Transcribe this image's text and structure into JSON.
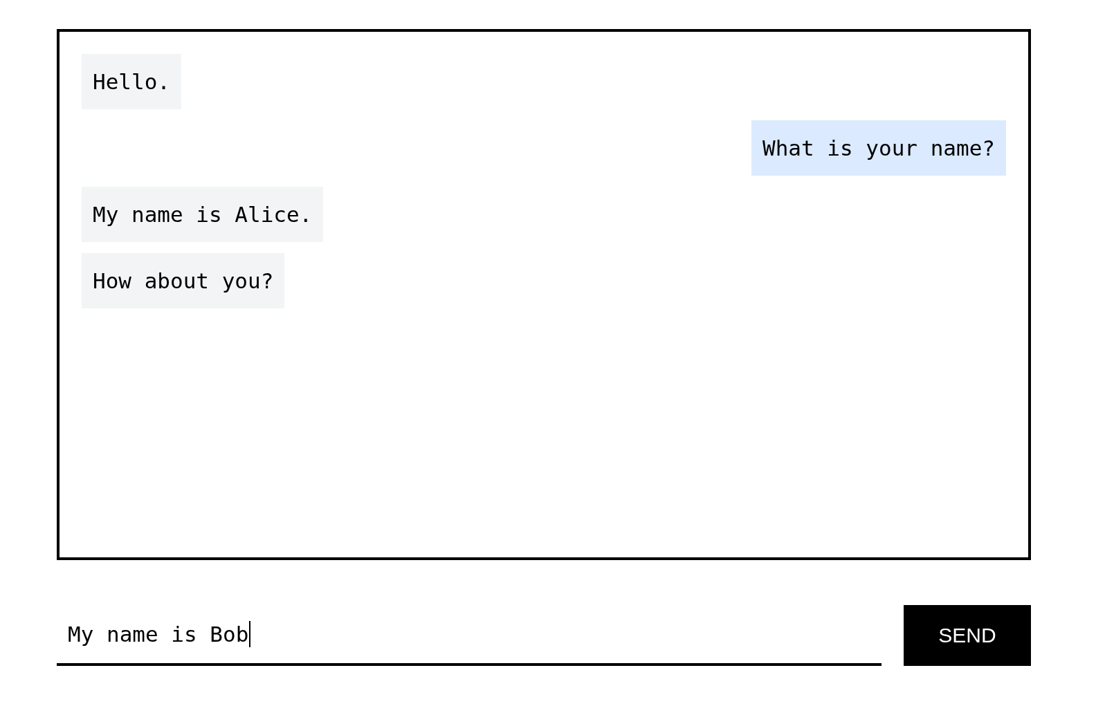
{
  "messages": [
    {
      "kind": "received",
      "text": "Hello."
    },
    {
      "kind": "sent",
      "text": "What is your name?"
    },
    {
      "kind": "received",
      "text": "My name is Alice."
    },
    {
      "kind": "received",
      "text": "How about you?"
    }
  ],
  "composer": {
    "value": "My name is Bob",
    "focused": true
  },
  "send_button": {
    "label": "SEND"
  }
}
